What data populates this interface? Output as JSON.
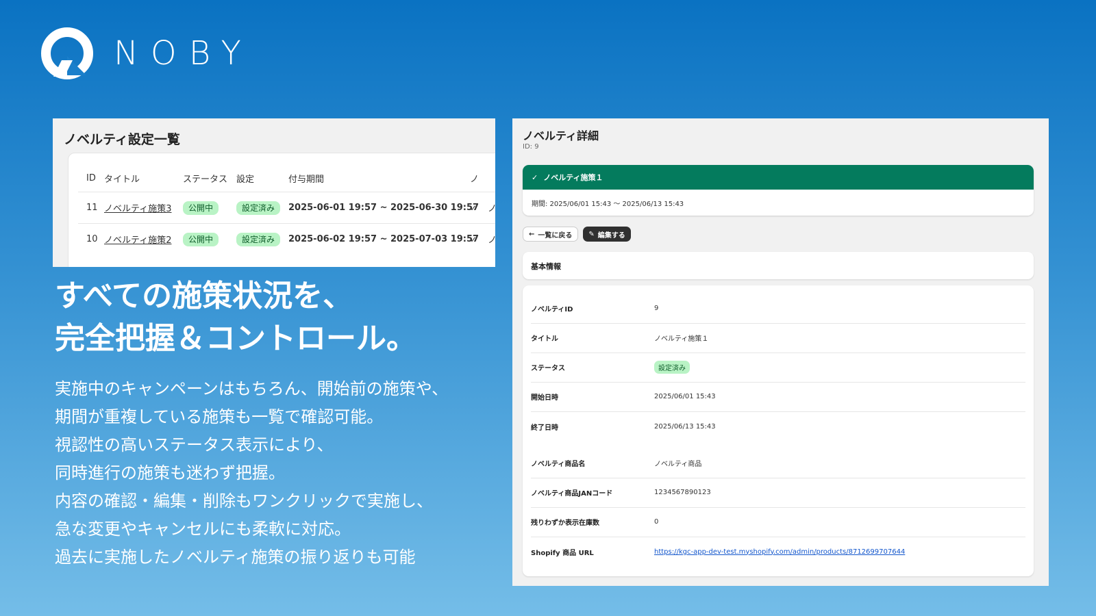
{
  "brand": {
    "name": "NOBY"
  },
  "list": {
    "title": "ノベルティ設定一覧",
    "headers": [
      "ID",
      "タイトル",
      "ステータス",
      "設定",
      "付与期間"
    ],
    "rows": [
      {
        "id": "11",
        "title": "ノベルティ施策3",
        "status": "公開中",
        "setting": "設定済み",
        "period": "2025-06-01 19:57 ~ 2025-06-30 19:57",
        "check": "✓"
      },
      {
        "id": "10",
        "title": "ノベルティ施策2",
        "status": "公開中",
        "setting": "設定済み",
        "period": "2025-06-02 19:57 ~ 2025-07-03 19:57",
        "check": "✓"
      }
    ]
  },
  "headline": {
    "line1": "すべての施策状況を、",
    "line2": "完全把握＆コントロール。"
  },
  "description": [
    "実施中のキャンペーンはもちろん、開始前の施策や、",
    "期間が重複している施策も一覧で確認可能。",
    "視認性の高いステータス表示により、",
    "同時進行の施策も迷わず把握。",
    "内容の確認・編集・削除もワンクリックで実施し、",
    "急な変更やキャンセルにも柔軟に対応。",
    "過去に実施したノベルティ施策の振り返りも可能"
  ],
  "detail": {
    "title": "ノベルティ詳細",
    "id_label": "ID: 9",
    "banner_title": "ノベルティ施策１",
    "banner_period": "期間: 2025/06/01 15:43 〜 2025/06/13 15:43",
    "back_button": "一覧に戻る",
    "edit_button": "編集する",
    "section_title": "基本情報",
    "fields": [
      {
        "label": "ノベルティID",
        "value": "9"
      },
      {
        "label": "タイトル",
        "value": "ノベルティ施策１"
      },
      {
        "label": "ステータス",
        "value": "設定済み"
      },
      {
        "label": "開始日時",
        "value": "2025/06/01 15:43"
      },
      {
        "label": "終了日時",
        "value": "2025/06/13 15:43"
      },
      {
        "label": "ノベルティ商品名",
        "value": "ノベルティ商品"
      },
      {
        "label": "ノベルティ商品JANコード",
        "value": "1234567890123"
      },
      {
        "label": "残りわずか表示在庫数",
        "value": "0"
      },
      {
        "label": "Shopify 商品 URL",
        "value": "https://kgc-app-dev-test.myshopify.com/admin/products/8712699707644"
      }
    ]
  },
  "colors": {
    "banner": "#047b5d",
    "badge_bg": "#b9f3c5",
    "badge_text": "#0f5d2b"
  }
}
